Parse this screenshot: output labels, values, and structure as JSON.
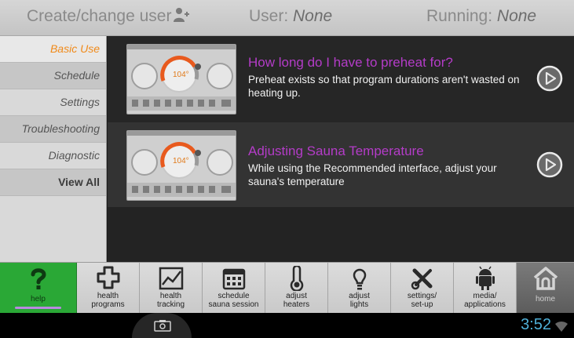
{
  "header": {
    "create_user": "Create/change user",
    "user_label": "User: ",
    "user_value": "None",
    "running_label": "Running: ",
    "running_value": "None"
  },
  "sidebar": {
    "items": [
      {
        "label": "Basic Use",
        "state": "active"
      },
      {
        "label": "Schedule"
      },
      {
        "label": "Settings"
      },
      {
        "label": "Troubleshooting"
      },
      {
        "label": "Diagnostic"
      },
      {
        "label": "View All"
      }
    ]
  },
  "cards": [
    {
      "title": "How long do I have to preheat for?",
      "description": "Preheat exists so that program durations aren't wasted on heating up.",
      "thumb_temp": "104°"
    },
    {
      "title": "Adjusting Sauna Temperature",
      "description": "While using the Recommended interface, adjust your sauna's temperature",
      "thumb_temp": "104°"
    }
  ],
  "bottom_nav": [
    {
      "label": "help",
      "icon": "question-mark-icon"
    },
    {
      "label": "health\nprograms",
      "icon": "plus-cross-icon"
    },
    {
      "label": "health\ntracking",
      "icon": "line-chart-icon"
    },
    {
      "label": "schedule\nsauna session",
      "icon": "calendar-icon"
    },
    {
      "label": "adjust\nheaters",
      "icon": "thermometer-icon"
    },
    {
      "label": "adjust\nlights",
      "icon": "lightbulb-icon"
    },
    {
      "label": "settings/\nset-up",
      "icon": "tools-icon"
    },
    {
      "label": "media/\napplications",
      "icon": "android-icon"
    },
    {
      "label": "home",
      "icon": "home-icon"
    }
  ],
  "system_bar": {
    "time": "3:52",
    "icons": [
      "camera-icon",
      "wifi-icon"
    ]
  },
  "colors": {
    "accent_orange": "#f08a1a",
    "card_title_purple": "#b43cc8",
    "help_green": "#2aa836",
    "clock_blue": "#4fb0d8"
  }
}
